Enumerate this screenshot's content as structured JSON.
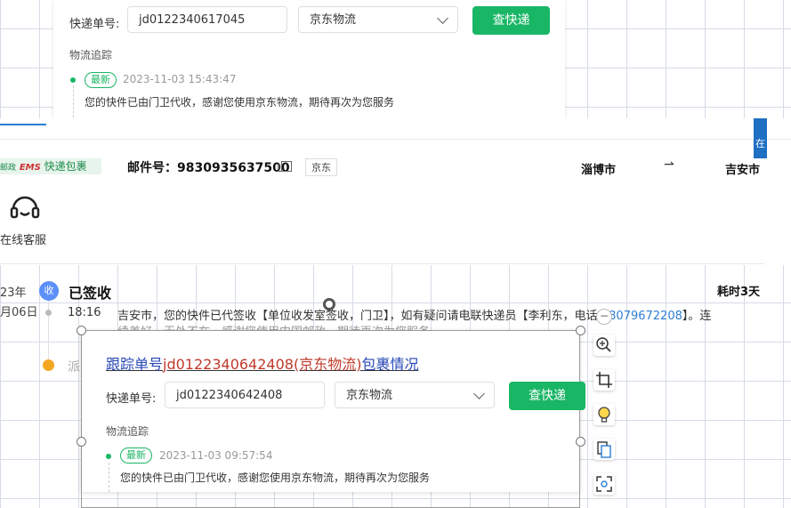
{
  "top_card": {
    "tracking_label": "快递单号:",
    "tracking_value": "jd0122340617045",
    "carrier": "京东物流",
    "search_button": "查快递",
    "section_title": "物流追踪",
    "latest_tag": "最新",
    "latest_time": "2023-11-03 15:43:47",
    "latest_msg": "您的快件已由门卫代收，感谢您使用京东物流，期待再次为您服务"
  },
  "page": {
    "side_tab": "在",
    "logo_text_post": "邮政",
    "logo_text_ems": "EMS",
    "logo_text_pkg": "快递包裹",
    "mail_no": "邮件号：9830935637500",
    "carrier_tag": "京东",
    "from_city": "淄博市",
    "arrow": "⇀",
    "to_city": "吉安市",
    "cs_label": "在线客服",
    "date_year": "23年",
    "date_day": "月06日",
    "status_icon": "收",
    "status": "已签收",
    "duration": "耗时3天",
    "time": "18:16",
    "detail_text": "吉安市，您的快件已代签收【单位收发室签收，门卫】，如有疑问请电联快递员【李利东，电话:",
    "detail_phone": "18079672208",
    "detail_tail": "】。连",
    "detail_line2": "续美好，无处不在，感谢您使用中国邮政，期待再次为您服务",
    "next_status": "派"
  },
  "bottom_card": {
    "title_prefix": "跟踪单号",
    "title_no": "jd0122340642408(京东物流)",
    "title_suffix": "包裹情况",
    "tracking_label": "快递单号:",
    "tracking_value": "jd0122340642408",
    "carrier": "京东物流",
    "search_button": "查快递",
    "section_title": "物流追踪",
    "latest_tag": "最新",
    "latest_time": "2023-11-03 09:57:54",
    "latest_msg": "您的快件已由门卫代收，感谢您使用京东物流，期待再次为您服务"
  },
  "toolbar": {
    "items": [
      "minus-icon",
      "zoom-in-icon",
      "crop-icon",
      "bulb-icon",
      "file-icon",
      "scan-icon"
    ]
  },
  "colors": {
    "green": "#19b665",
    "blue": "#2d7dd2",
    "orange": "#f5a623"
  }
}
